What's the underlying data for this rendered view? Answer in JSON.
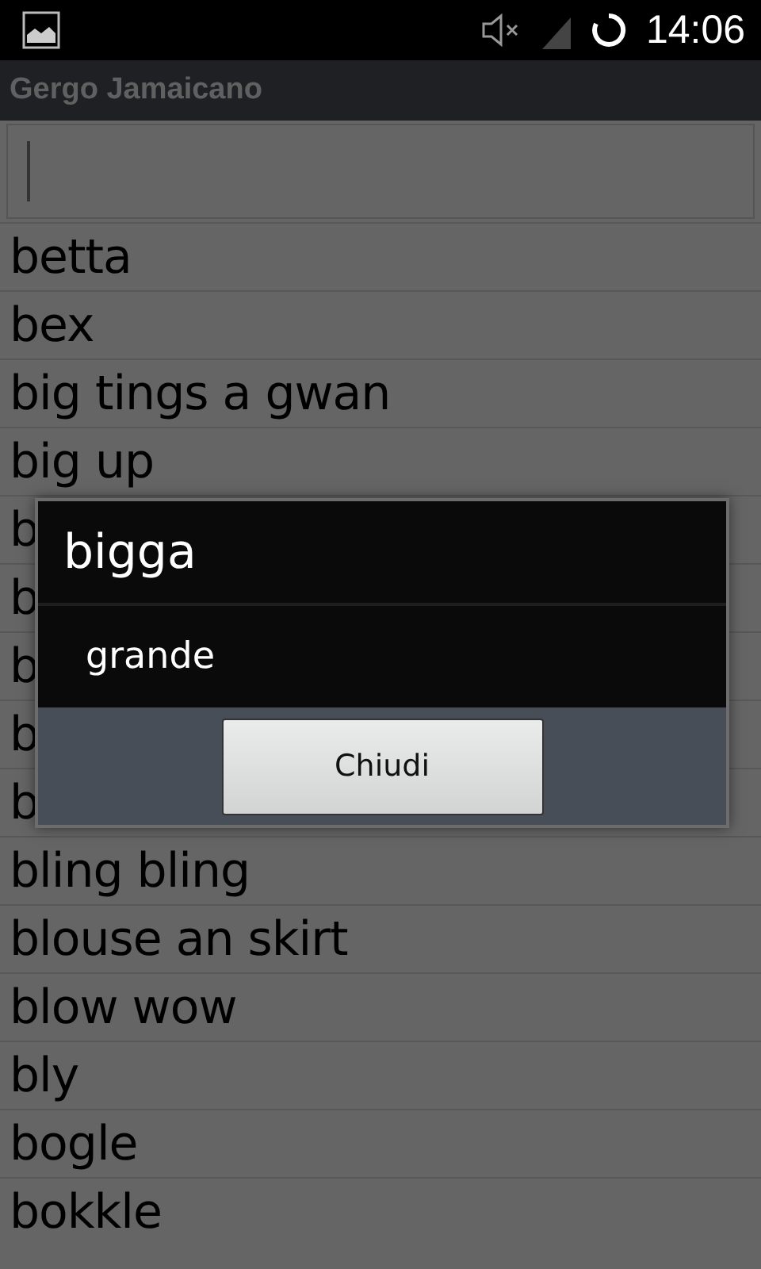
{
  "status_bar": {
    "time": "14:06"
  },
  "action_bar": {
    "title": "Gergo Jamaicano"
  },
  "list": [
    "betta",
    "bex",
    "big tings a gwan",
    "big up",
    "b",
    "b",
    "b",
    "b",
    "b",
    "bling bling",
    "blouse an skirt",
    "blow wow",
    "bly",
    "bogle",
    "bokkle"
  ],
  "dialog": {
    "title": "bigga",
    "message": "grande",
    "button": "Chiudi"
  }
}
